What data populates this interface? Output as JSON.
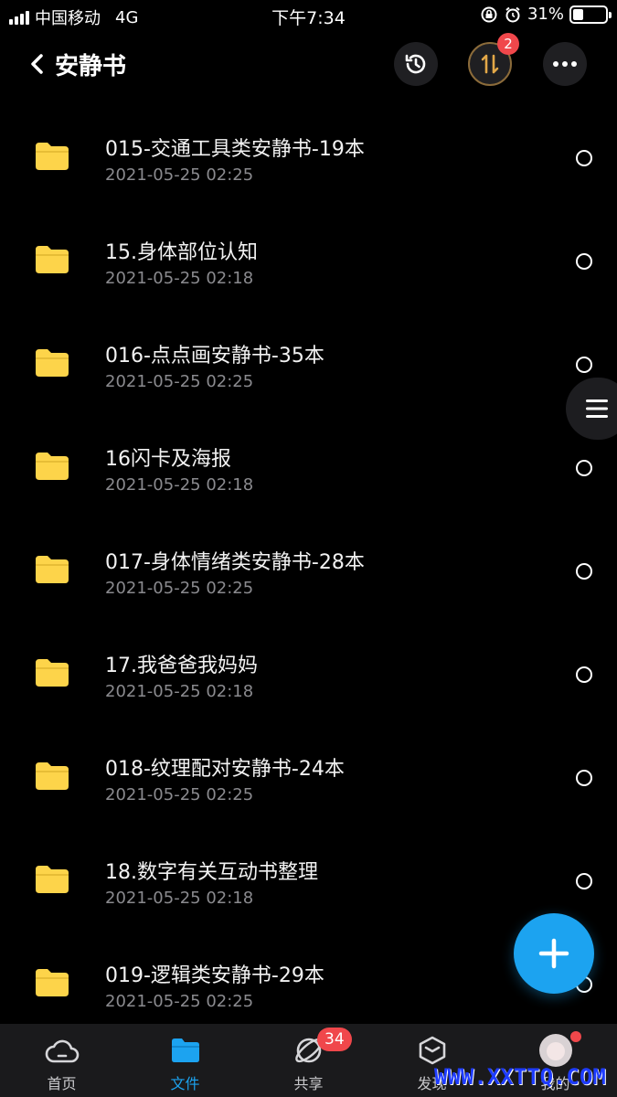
{
  "status_bar": {
    "carrier": "中国移动",
    "network": "4G",
    "time": "下午7:34",
    "battery": "31%",
    "battery_level": 0.31
  },
  "header": {
    "title": "安静书",
    "transfer_badge": "2"
  },
  "files": [
    {
      "name": "015-交通工具类安静书-19本",
      "date": "2021-05-25 02:25"
    },
    {
      "name": "15.身体部位认知",
      "date": "2021-05-25 02:18"
    },
    {
      "name": "016-点点画安静书-35本",
      "date": "2021-05-25 02:25"
    },
    {
      "name": "16闪卡及海报",
      "date": "2021-05-25 02:18"
    },
    {
      "name": "017-身体情绪类安静书-28本",
      "date": "2021-05-25 02:25"
    },
    {
      "name": "17.我爸爸我妈妈",
      "date": "2021-05-25 02:18"
    },
    {
      "name": "018-纹理配对安静书-24本",
      "date": "2021-05-25 02:25"
    },
    {
      "name": "18.数字有关互动书整理",
      "date": "2021-05-25 02:18"
    },
    {
      "name": "019-逻辑类安静书-29本",
      "date": "2021-05-25 02:25"
    }
  ],
  "tabs": [
    {
      "label": "首页",
      "icon": "cloud-icon"
    },
    {
      "label": "文件",
      "icon": "folder-icon"
    },
    {
      "label": "共享",
      "icon": "share-icon",
      "badge": "34"
    },
    {
      "label": "发现",
      "icon": "discover-icon"
    },
    {
      "label": "我的",
      "icon": "avatar"
    }
  ],
  "watermark": "WWW.XXTTQ.COM",
  "colors": {
    "accent": "#1ca3f0",
    "folder": "#fdd44a",
    "badge": "#f0474b",
    "background": "#000000"
  }
}
